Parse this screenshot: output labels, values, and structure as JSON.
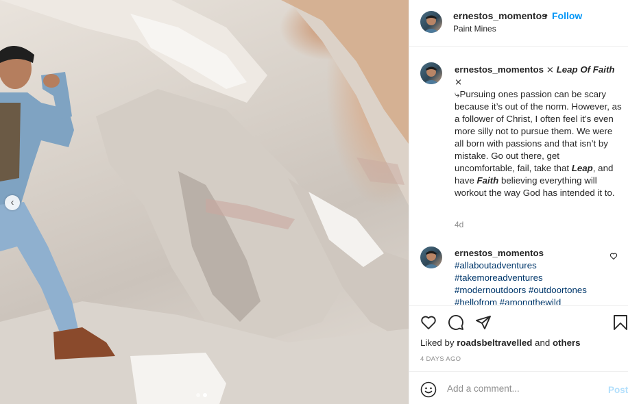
{
  "post": {
    "username": "ernestos_momentos",
    "separator": "•",
    "follow_label": "Follow",
    "location": "Paint Mines"
  },
  "caption": {
    "username": "ernestos_momentos",
    "title_prefix": " ⨯ ",
    "title": "Leap Of Faith",
    "title_suffix": " ⨯",
    "text_1": "⤷Pursuing ones passion can be scary because it’s out of the norm. However, as a follower of Christ, I often feel it’s even more silly not to pursue them. We were all born with passions and that isn’t by mistake. Go out there, get uncomfortable, fail, take that ",
    "kw_1": "Leap",
    "text_2": ", and have ",
    "kw_2": "Faith",
    "text_3": " believing everything will workout the way God has intended it to.",
    "time": "4d"
  },
  "comment": {
    "username": "ernestos_momentos",
    "tags": [
      "#allaboutadventures",
      "#takemoreadventures",
      "#modernoutdoors",
      "#outdoortones",
      "#hellofrom",
      "#amongthewild"
    ]
  },
  "likes": {
    "prefix": "Liked by ",
    "user": "roadsbeltravelled",
    "middle": " and ",
    "others": "others"
  },
  "time_ago": "4 DAYS AGO",
  "add_comment": {
    "placeholder": "Add a comment...",
    "post_label": "Post"
  },
  "carousel": {
    "total": 2,
    "current": 2
  },
  "icons": {
    "like": "heart-icon",
    "comment": "comment-icon",
    "share": "share-icon",
    "save": "bookmark-icon",
    "emoji": "emoji-icon",
    "prev": "chevron-left-icon"
  },
  "colors": {
    "link": "#0095f6",
    "hashtag": "#00376b",
    "muted": "#8e8e8e",
    "post_disabled": "#b2dffc"
  }
}
